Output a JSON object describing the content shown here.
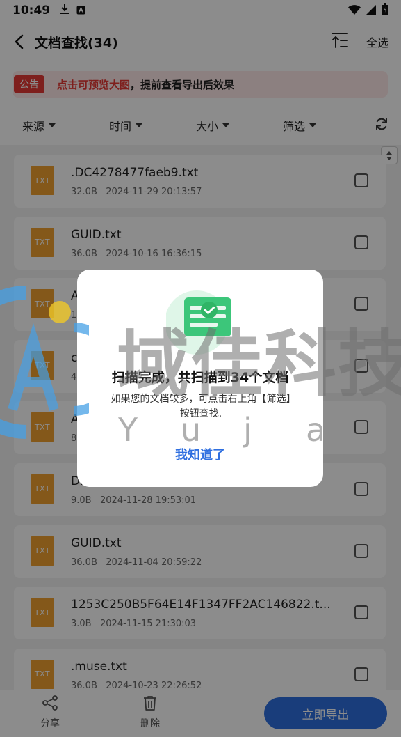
{
  "status_bar": {
    "time": "10:49"
  },
  "header": {
    "title": "文档查找(34)",
    "select_all": "全选"
  },
  "notice": {
    "badge": "公告",
    "highlight": "点击可预览大图",
    "rest": "，提前查看导出后效果"
  },
  "filters": [
    {
      "label": "来源"
    },
    {
      "label": "时间"
    },
    {
      "label": "大小"
    },
    {
      "label": "筛选"
    }
  ],
  "files": [
    {
      "icon_label": "TXT",
      "name": ".DC4278477faeb9.txt",
      "size": "32.0B",
      "date": "2024-11-29 20:13:57"
    },
    {
      "icon_label": "TXT",
      "name": "GUID.txt",
      "size": "36.0B",
      "date": "2024-10-16 16:36:15"
    },
    {
      "icon_label": "TXT",
      "name": "A",
      "size": "1",
      "date": ""
    },
    {
      "icon_label": "TXT",
      "name": "c",
      "size": "4",
      "date": ""
    },
    {
      "icon_label": "TXT",
      "name": "A",
      "size": "8",
      "date": ""
    },
    {
      "icon_label": "TXT",
      "name": "Di",
      "size": "9.0B",
      "date": "2024-11-28 19:53:01"
    },
    {
      "icon_label": "TXT",
      "name": "GUID.txt",
      "size": "36.0B",
      "date": "2024-11-04 20:59:22"
    },
    {
      "icon_label": "TXT",
      "name": "1253C250B5F64E14F1347FF2AC146822.t...",
      "size": "3.0B",
      "date": "2024-11-15 21:30:03"
    },
    {
      "icon_label": "TXT",
      "name": ".muse.txt",
      "size": "36.0B",
      "date": "2024-10-23 22:26:52"
    }
  ],
  "bottom_bar": {
    "share": "分享",
    "delete": "删除",
    "export": "立即导出"
  },
  "dialog": {
    "title": "扫描完成，共扫描到34个文档",
    "description": "如果您的文档较多，可点击右上角【筛选】按钮查找.",
    "confirm": "我知道了"
  },
  "watermark": {
    "text": "域佳科技",
    "letters": [
      "Y",
      "u",
      "j",
      "a"
    ]
  },
  "colors": {
    "accent": "#2f6fe0",
    "notice_red": "#e53935",
    "file_icon": "#f0a030",
    "success_green": "#3cc67a"
  }
}
